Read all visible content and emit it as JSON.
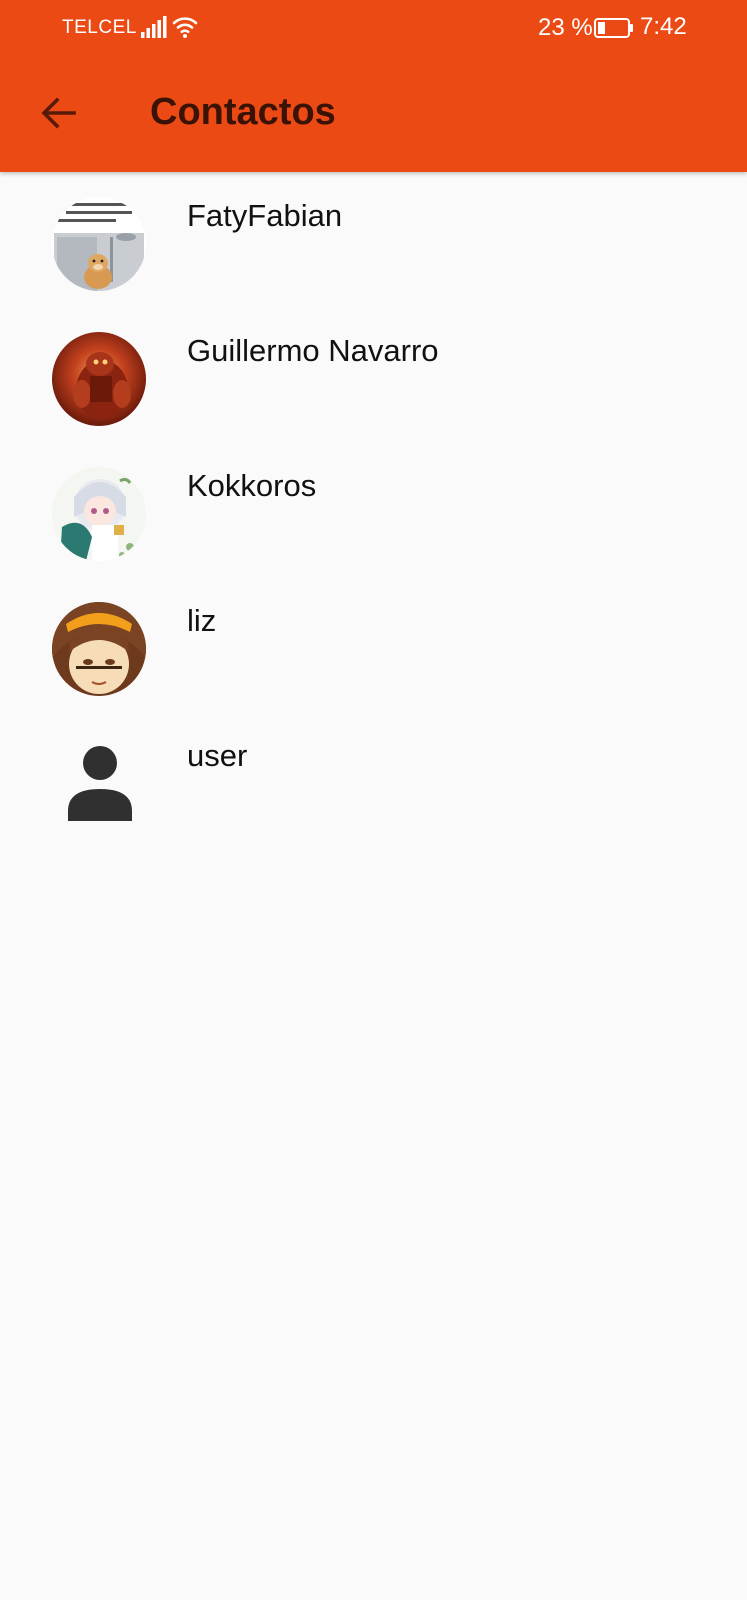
{
  "status_bar": {
    "carrier": "TELCEL",
    "battery_percent": "23 %",
    "time": "7:42"
  },
  "app_bar": {
    "title": "Contactos",
    "back_icon": "arrow-back-icon"
  },
  "contacts": [
    {
      "name": "FatyFabian",
      "avatar": "photo-doge-shower"
    },
    {
      "name": "Guillermo Navarro",
      "avatar": "photo-fiery-monster"
    },
    {
      "name": "Kokkoros",
      "avatar": "photo-anime-white-hair"
    },
    {
      "name": "liz",
      "avatar": "photo-anime-orange-ribbon"
    },
    {
      "name": "user",
      "avatar": "person-icon"
    }
  ],
  "colors": {
    "app_bar": "#ec4a14",
    "background": "#fafafa",
    "title_text": "#3a1206"
  }
}
